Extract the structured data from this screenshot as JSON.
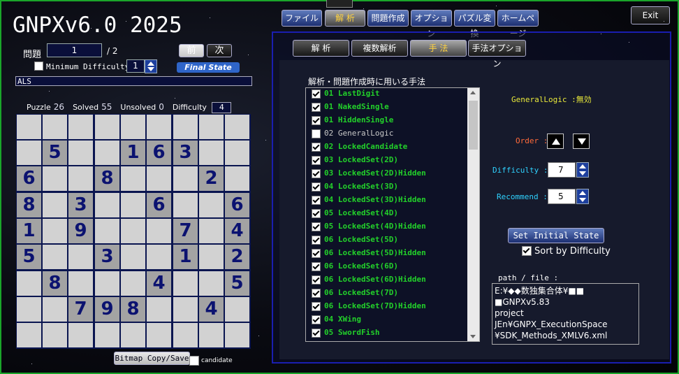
{
  "app_title": "GNPXv6.0 2025",
  "menu": [
    "ファイル",
    "解 析",
    "問題作成",
    "オプション",
    "パズル変換",
    "ホームページ"
  ],
  "menu_active_index": 1,
  "exit_label": "Exit",
  "left": {
    "problem_label": "問題",
    "problem_value": "1",
    "problem_total": "/ 2",
    "prev_label": "前",
    "next_label": "次",
    "min_difficulty_label": "Minimum Difficulty",
    "min_difficulty_value": "1",
    "final_state_label": "Final State",
    "method_text": "ALS",
    "stats": {
      "puzzle_label": "Puzzle",
      "puzzle_value": "26",
      "solved_label": "Solved",
      "solved_value": "55",
      "unsolved_label": "Unsolved",
      "unsolved_value": "0",
      "difficulty_label": "Difficulty",
      "difficulty_value": "4"
    },
    "grid": [
      "000000000",
      "050016300",
      "600800020",
      "803006006",
      "109000704",
      "500300102",
      "080004005",
      "007980040",
      "000000000"
    ],
    "bitmap_label": "Bitmap Copy/Save",
    "candidate_label": "candidate"
  },
  "subtabs": [
    "解 析",
    "複数解析",
    "手 法",
    "手法オプション"
  ],
  "subtab_active_index": 2,
  "methods_header": "解析・問題作成時に用いる手法",
  "methods": [
    {
      "checked": true,
      "text": "01 LastDigit"
    },
    {
      "checked": true,
      "text": "01 NakedSingle"
    },
    {
      "checked": true,
      "text": "01 HiddenSingle"
    },
    {
      "checked": false,
      "text": "02  GeneralLogic"
    },
    {
      "checked": true,
      "text": "02 LockedCandidate"
    },
    {
      "checked": true,
      "text": "03 LockedSet(2D)"
    },
    {
      "checked": true,
      "text": "03 LockedSet(2D)Hidden"
    },
    {
      "checked": true,
      "text": "04 LockedSet(3D)"
    },
    {
      "checked": true,
      "text": "04 LockedSet(3D)Hidden"
    },
    {
      "checked": true,
      "text": "05 LockedSet(4D)"
    },
    {
      "checked": true,
      "text": "05 LockedSet(4D)Hidden"
    },
    {
      "checked": true,
      "text": "06 LockedSet(5D)"
    },
    {
      "checked": true,
      "text": "06 LockedSet(5D)Hidden"
    },
    {
      "checked": true,
      "text": "06 LockedSet(6D)"
    },
    {
      "checked": true,
      "text": "06 LockedSet(6D)Hidden"
    },
    {
      "checked": true,
      "text": "06 LockedSet(7D)"
    },
    {
      "checked": true,
      "text": "06 LockedSet(7D)Hidden"
    },
    {
      "checked": true,
      "text": "04 XWing"
    },
    {
      "checked": true,
      "text": "05 SwordFish"
    }
  ],
  "general_logic_status": "GeneralLogic :無効",
  "order_label": "Order :",
  "difficulty_label": "Difficulty :",
  "difficulty_value": "7",
  "recommend_label": "Recommend :",
  "recommend_value": "5",
  "set_initial_label": "Set Initial State",
  "sort_label": "Sort by Difficulty",
  "path_label": "path / file :",
  "path_lines": [
    "E:¥◆◆数独集合体¥■■ ■GNPXv5.83",
    "project JEn¥GNPX_ExecutionSpace",
    "¥SDK_Methods_XMLV6.xml"
  ],
  "colors": {
    "accent_green": "#22d02a",
    "order_red": "#ff6a3a",
    "label_cyan": "#2fd2ff",
    "status_yellow": "#e8e83a",
    "active_tab": "#ffd23f"
  }
}
